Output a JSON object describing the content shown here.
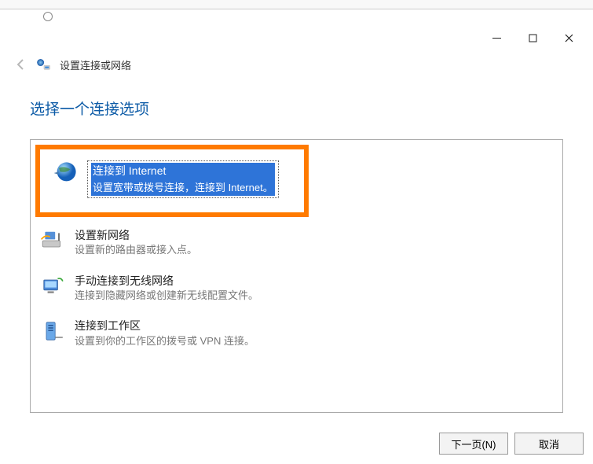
{
  "window": {
    "title": "设置连接或网络"
  },
  "page": {
    "heading": "选择一个连接选项"
  },
  "options": [
    {
      "title": "连接到 Internet",
      "desc": "设置宽带或拨号连接，连接到 Internet。",
      "selected": true
    },
    {
      "title": "设置新网络",
      "desc": "设置新的路由器或接入点。",
      "selected": false
    },
    {
      "title": "手动连接到无线网络",
      "desc": "连接到隐藏网络或创建新无线配置文件。",
      "selected": false
    },
    {
      "title": "连接到工作区",
      "desc": "设置到你的工作区的拨号或 VPN 连接。",
      "selected": false
    }
  ],
  "buttons": {
    "next": "下一页(N)",
    "cancel": "取消"
  }
}
